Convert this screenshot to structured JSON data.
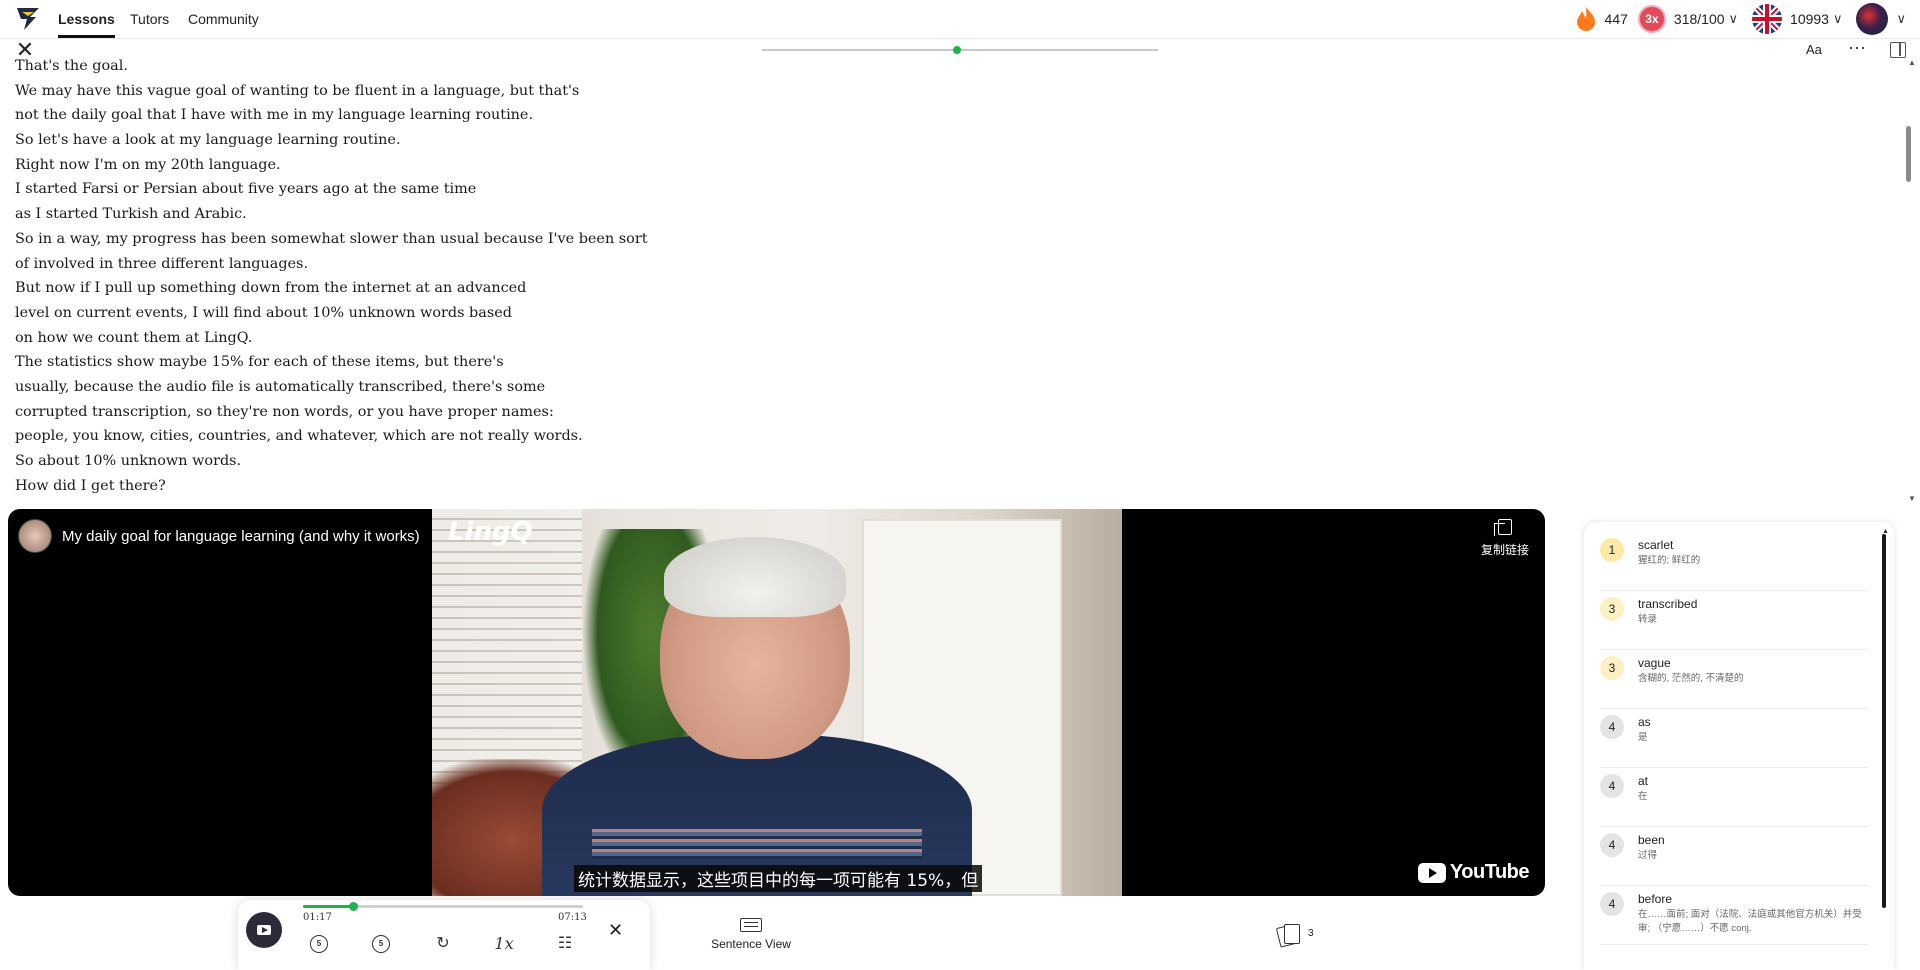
{
  "nav": {
    "tabs": [
      "Lessons",
      "Tutors",
      "Community"
    ],
    "streak": "447",
    "multiplier": "3x",
    "daily_goal": "318/100",
    "known_words": "10993",
    "flame_color": "#ff7a1a"
  },
  "reader": {
    "font_button": "Aa",
    "lines": [
      "That's the goal.",
      "We may have this vague goal of wanting to be fluent in a language, but that's",
      "not the daily goal that I have with me in my language learning routine.",
      "So let's have a look at my language learning routine.",
      "Right now I'm on my 20th language.",
      "I started Farsi or Persian about five years ago at the same time",
      "as I started Turkish and Arabic.",
      "So in a way, my progress has been somewhat slower than usual because I've been sort",
      "of involved in three different languages.",
      "But now if I pull up something down from the internet at an advanced",
      "level on current events, I will find about 10% unknown words based",
      "on how we count them at LingQ.",
      "The statistics show maybe 15% for each of these items, but there's",
      "usually, because the audio file is automatically transcribed, there's some",
      "corrupted transcription, so they're non words, or you have proper names:",
      "people, you know, cities, countries, and whatever, which are not really words.",
      "So about 10% unknown words.",
      "How did I get there?"
    ]
  },
  "video": {
    "title": "My daily goal for language learning (and why it works)",
    "watermark": "LingQ",
    "copy_link": "复制链接",
    "youtube": "YouTube",
    "subtitle": "统计数据显示，这些项目中的每一项可能有 15%，但"
  },
  "player": {
    "current_time": "01:17",
    "duration": "07:13",
    "progress_fraction": 0.18,
    "rewind_label": "5",
    "forward_label": "5",
    "speed_label": "1x"
  },
  "footer": {
    "sentence_view": "Sentence View",
    "cards_count": "3"
  },
  "vocab": [
    {
      "level": "1",
      "word": "scarlet",
      "translation": "猩红的; 鲜红的",
      "color": "#fde9a6"
    },
    {
      "level": "3",
      "word": "transcribed",
      "translation": "转录",
      "color": "#fdf1c4"
    },
    {
      "level": "3",
      "word": "vague",
      "translation": "含糊的, 茫然的, 不清楚的",
      "color": "#fdf1c4"
    },
    {
      "level": "4",
      "word": "as",
      "translation": "是",
      "color": "#e4e4e4"
    },
    {
      "level": "4",
      "word": "at",
      "translation": "在",
      "color": "#e4e4e4"
    },
    {
      "level": "4",
      "word": "been",
      "translation": "过得",
      "color": "#e4e4e4"
    },
    {
      "level": "4",
      "word": "before",
      "translation": "在……面前; 面对（法院、法庭或其他官方机关）并受审; （宁愿……）不愿 conj.",
      "color": "#e4e4e4"
    }
  ]
}
